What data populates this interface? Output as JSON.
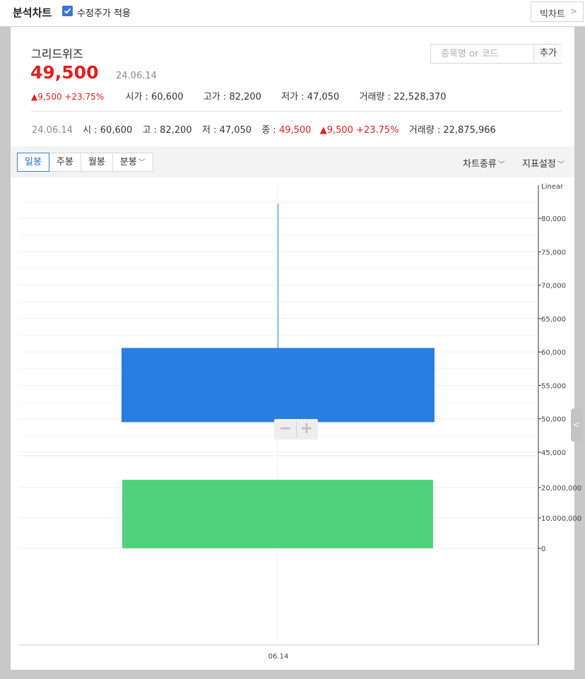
{
  "topbar": {
    "title": "분석차트",
    "adjusted_price_label": "수정주가 적용",
    "adjusted_price_checked": true,
    "big_chart_label": "빅차트"
  },
  "stock": {
    "name": "그리드위즈",
    "price": "49,500",
    "date": "24.06.14",
    "change": "▲9,500 +23.75%",
    "open_label": "시가 : ",
    "open": "60,600",
    "high_label": "고가 : ",
    "high": "82,200",
    "low_label": "저가 : ",
    "low": "47,050",
    "volume_label": "거래량 : ",
    "volume": "22,528,370"
  },
  "search": {
    "placeholder": "종목명 or 코드",
    "add_label": "추가"
  },
  "daily": {
    "date": "24.06.14",
    "open_label": "시 : ",
    "open": "60,600",
    "high_label": "고 : ",
    "high": "82,200",
    "low_label": "저 : ",
    "low": "47,050",
    "close_label": "종 : ",
    "close": "49,500",
    "change": "▲9,500 +23.75%",
    "volume_label": "거래량 : ",
    "volume": "22,875,966"
  },
  "tabs": {
    "periods": [
      {
        "label": "일봉",
        "active": true
      },
      {
        "label": "주봉",
        "active": false
      },
      {
        "label": "월봉",
        "active": false
      },
      {
        "label": "분봉",
        "active": false,
        "dropdown": true
      }
    ],
    "chart_type_label": "차트종류",
    "indicator_label": "지표설정"
  },
  "chart_data": {
    "type": "candlestick",
    "scale_label": "Linear",
    "price_ticks": [
      80000,
      75000,
      70000,
      65000,
      60000,
      55000,
      50000,
      45000
    ],
    "price_tick_labels": [
      "80,000",
      "75,000",
      "70,000",
      "65,000",
      "60,000",
      "55,000",
      "50,000",
      "45,000"
    ],
    "volume_ticks": [
      20000000,
      10000000,
      0
    ],
    "volume_tick_labels": [
      "20,000,000",
      "10,000,000",
      "0"
    ],
    "x_tick_labels": [
      "06.14"
    ],
    "candles": [
      {
        "date": "06.14",
        "open": 60600,
        "high": 82200,
        "low": 47050,
        "close": 49500,
        "volume": 22528370
      }
    ],
    "colors": {
      "down": "#2a7de1",
      "volume": "#52d17c",
      "wick": "#2a7de1"
    }
  },
  "colors": {
    "up": "#e0201f",
    "accent": "#3a7fd5"
  }
}
